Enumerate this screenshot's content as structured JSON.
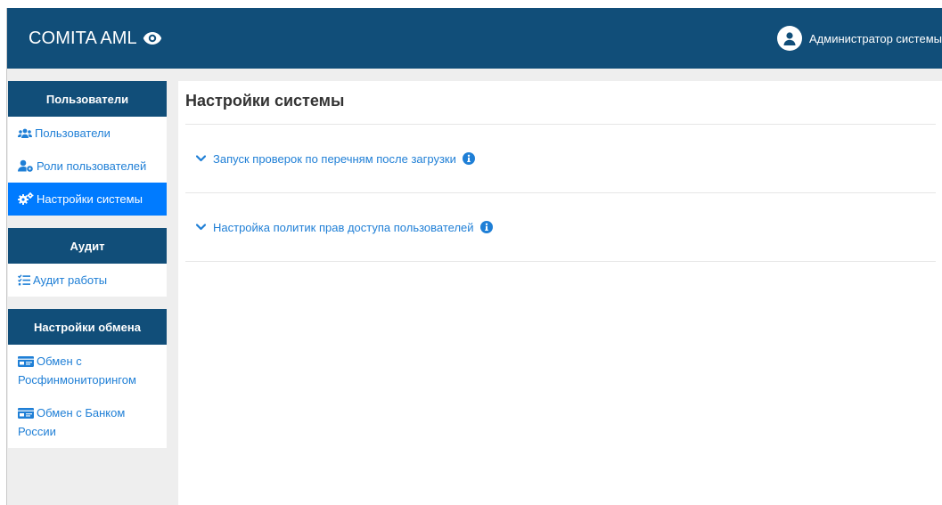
{
  "header": {
    "brand": "COMITA AML",
    "user_name": "Администратор системы"
  },
  "sidebar": {
    "groups": [
      {
        "title": "Пользователи",
        "items": [
          {
            "label": "Пользователи",
            "icon": "users-icon"
          },
          {
            "label": "Роли пользователей",
            "icon": "user-cog-icon"
          },
          {
            "label": "Настройки системы",
            "icon": "cogs-icon",
            "active": true
          }
        ]
      },
      {
        "title": "Аудит",
        "items": [
          {
            "label": "Аудит работы",
            "icon": "tasks-icon"
          }
        ]
      },
      {
        "title": "Настройки обмена",
        "items": [
          {
            "label": "Обмен с Росфинмониторингом",
            "icon": "id-card-icon"
          },
          {
            "label": "Обмен с Банком России",
            "icon": "id-card-icon"
          }
        ]
      }
    ]
  },
  "main": {
    "title": "Настройки системы",
    "sections": [
      {
        "label": "Запуск проверок по перечням после загрузки"
      },
      {
        "label": "Настройка политик прав доступа пользователей"
      }
    ]
  },
  "colors": {
    "header_bg": "#114e79",
    "accent": "#007bff",
    "link": "#1f7fd6"
  }
}
